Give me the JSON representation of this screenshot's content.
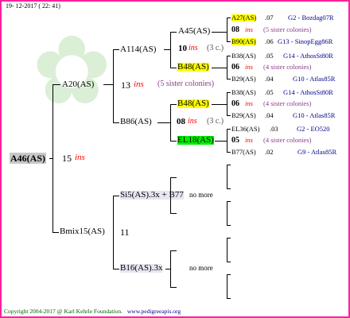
{
  "header": {
    "date": "19- 12-2017 ( 22: 41)"
  },
  "footer": {
    "copyright": "Copyright 2004-2017 @ Karl Kehrle Foundation.",
    "url": "www.pedigreeapis.org"
  },
  "root": {
    "label": "A46(AS)",
    "num": "15",
    "ins": "ins"
  },
  "gen1": {
    "top": {
      "label": "A20(AS)",
      "num": "13",
      "ins": "ins",
      "note": "(5 sister colonies)"
    },
    "bottom": {
      "label": "Bmix15(AS)",
      "num": "11"
    }
  },
  "gen2": {
    "a114": {
      "label": "A114(AS)"
    },
    "b86": {
      "label": "B86(AS)"
    },
    "si5": {
      "label": "Si5(AS).3x + B77",
      "more": "no more"
    },
    "b16": {
      "label": "B16(AS).3x",
      "more": "no more"
    }
  },
  "gen3": {
    "a45": {
      "label": "A45(AS)",
      "num": "10",
      "ins": "ins",
      "note": "(3 c.)"
    },
    "b48a": {
      "label": "B48(AS)"
    },
    "b48b": {
      "label": "B48(AS)",
      "num": "08",
      "ins": "ins",
      "note": "(3 c.)"
    },
    "el18": {
      "label": "EL18(AS)"
    }
  },
  "gen4": [
    {
      "label": "A27(AS)",
      "val": ".07",
      "right": "G2 - Bozdag07R",
      "hl": "yel"
    },
    {
      "num": "08",
      "ins": "ins",
      "note": "(5 sister colonies)"
    },
    {
      "label": "B90(AS)",
      "val": ".06",
      "right": "G13 - SinopEgg86R",
      "hl": "yel"
    },
    {
      "label": "B38(AS)",
      "val": ".05",
      "right": "G14 - AthosSt80R"
    },
    {
      "num": "06",
      "ins": "ins",
      "note": "(4 sister colonies)"
    },
    {
      "label": "B29(AS)",
      "val": ".04",
      "right": "G10 - Atlas85R"
    },
    {
      "label": "B38(AS)",
      "val": ".05",
      "right": "G14 - AthosSt80R"
    },
    {
      "num": "06",
      "ins": "ins",
      "note": "(4 sister colonies)"
    },
    {
      "label": "B29(AS)",
      "val": ".04",
      "right": "G10 - Atlas85R"
    },
    {
      "label": "EL36(AS)",
      "val": ".03",
      "right": "G2 - EO520"
    },
    {
      "num": "05",
      "ins": "ins",
      "note": "(4 sister colonies)"
    },
    {
      "label": "B77(AS)",
      "val": ".02",
      "right": "G9 - Atlas85R"
    }
  ],
  "colors": {
    "frame": "#ff1fa0",
    "highlight_yellow": "#ffff00",
    "highlight_green": "#00ee00",
    "ins_red": "#ff0000"
  }
}
